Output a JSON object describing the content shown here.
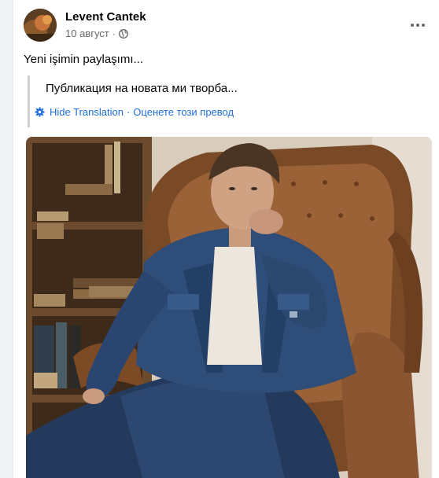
{
  "post": {
    "author": {
      "name": "Levent Cantek"
    },
    "date": "10 август",
    "privacy_icon": "globe-icon",
    "more_icon": "more-horizontal-icon",
    "text": "Yeni işimin paylaşımı...",
    "translation": {
      "text": "Публикация на новата ми творба...",
      "settings_icon": "gear-icon",
      "hide_label": "Hide Translation",
      "rate_label": "Оценете този превод",
      "separator": "·"
    },
    "photo": {
      "subject": "man-in-denim-on-leather-armchair"
    },
    "colors": {
      "name": "#050505",
      "meta": "#65676b",
      "link": "#216fdb",
      "quote_bar": "#ced0d4"
    }
  }
}
